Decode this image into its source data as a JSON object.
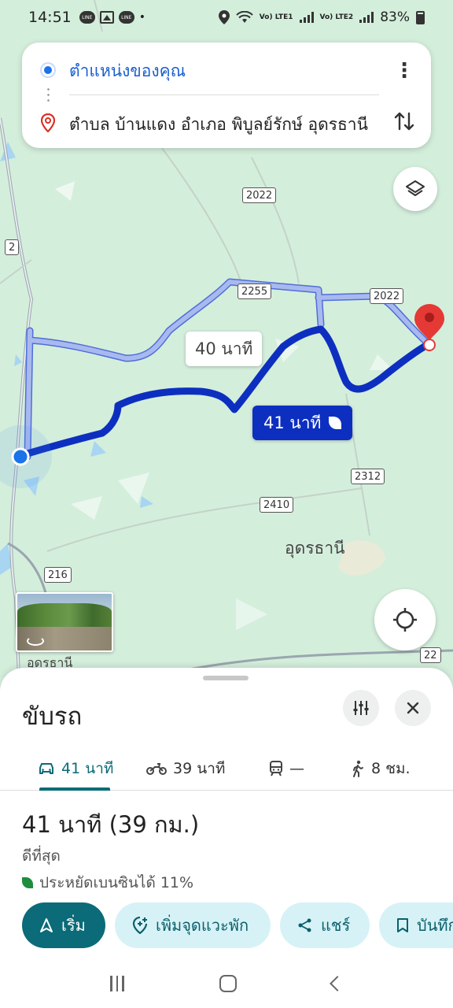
{
  "status_bar": {
    "time": "14:51",
    "notifications": [
      "line-icon",
      "gallery-icon",
      "line-icon"
    ],
    "battery": "83%",
    "sim1": "Vo) LTE1",
    "sim2": "Vo) LTE2"
  },
  "search": {
    "origin": "ตำแหน่งของคุณ",
    "destination": "ตำบล บ้านแดง อำเภอ พิบูลย์รักษ์ อุดรธานี"
  },
  "map": {
    "route_main_label": "41 นาที",
    "route_alt_label": "40 นาที",
    "shields": {
      "r2022a": "2022",
      "r2": "2",
      "r2255": "2255",
      "r2022b": "2022",
      "r2312": "2312",
      "r2410": "2410",
      "r216": "216",
      "r22": "22"
    },
    "place_label": "อุดรธานี",
    "streetview_label": "อุดรธานี",
    "colors": {
      "route_main": "#0d2fc0",
      "route_alt": "#a9b9ef",
      "pin": "#e53935"
    }
  },
  "sheet": {
    "title": "ขับรถ",
    "tabs": [
      {
        "icon": "car-icon",
        "label": "41 นาที",
        "active": true
      },
      {
        "icon": "motorcycle-icon",
        "label": "39 นาที",
        "active": false
      },
      {
        "icon": "train-icon",
        "label": "—",
        "active": false
      },
      {
        "icon": "walk-icon",
        "label": "8 ชม.",
        "active": false
      }
    ],
    "summary": "41 นาที (39 กม.)",
    "best": "ดีที่สุด",
    "eco": "ประหยัดเบนซินได้ 11%",
    "actions": {
      "start": "เริ่ม",
      "add_stop": "เพิ่มจุดแวะพัก",
      "share": "แชร์",
      "save": "บันทึก"
    },
    "accent": "#0b6b78"
  }
}
